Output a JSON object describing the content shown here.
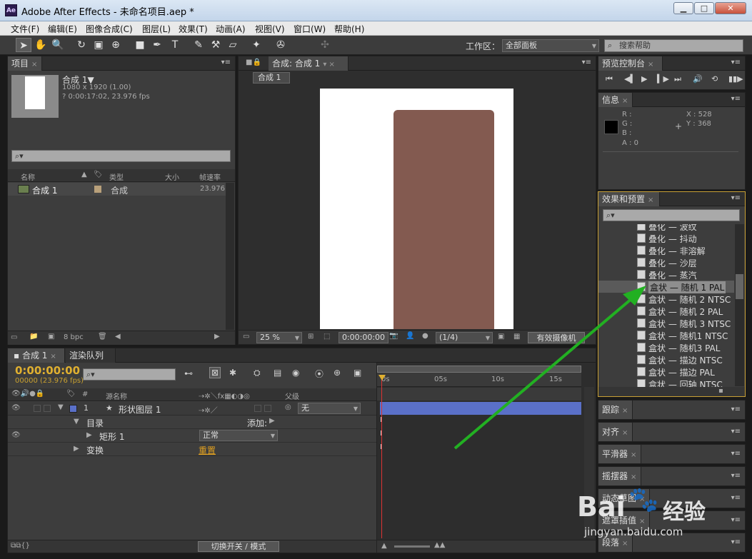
{
  "app": {
    "title": "Adobe After Effects - 未命名项目.aep *",
    "icon": "Ae"
  },
  "window_controls": {
    "minimize": "▁",
    "maximize": "□",
    "close": "✕"
  },
  "menu": [
    "文件(F)",
    "编辑(E)",
    "图像合成(C)",
    "图层(L)",
    "效果(T)",
    "动画(A)",
    "视图(V)",
    "窗口(W)",
    "帮助(H)"
  ],
  "toolbar": {
    "tools": [
      "selection-tool",
      "hand-tool",
      "zoom-tool",
      "rotate-tool",
      "camera-tool",
      "pan-behind-tool",
      "rectangle-tool",
      "pen-tool",
      "type-tool",
      "brush-tool",
      "clone-stamp-tool",
      "eraser-tool",
      "roto-brush-tool",
      "puppet-pin-tool"
    ],
    "workspace_label": "工作区：",
    "workspace_value": "全部面板",
    "search_help": "搜索帮助"
  },
  "project": {
    "tab": "项目",
    "comp_name": "合成 1▼",
    "comp_size": "1080 x 1920 (1.00)",
    "comp_duration": "? 0:00:17:02, 23.976 fps",
    "col_name": "名称",
    "col_type": "类型",
    "col_size": "大小",
    "col_fps": "帧速率",
    "item_name": "合成 1",
    "item_type": "合成",
    "item_fps": "23.976",
    "bpc": "8 bpc"
  },
  "composition": {
    "tab": "合成: 合成 1",
    "subtab": "合成 1",
    "zoom": "25 %",
    "timecode": "0:00:00:00",
    "resolution": "(1/4)",
    "camera": "有效摄像机",
    "shape_color": "#835a50"
  },
  "preview": {
    "tab": "预览控制台"
  },
  "info": {
    "tab": "信息",
    "r": "R :",
    "g": "G :",
    "b": "B :",
    "a": "A : 0",
    "x": "X : 528",
    "y": "Y : 368"
  },
  "effects": {
    "tab": "效果和预置",
    "items": [
      "叠化 — 波纹",
      "叠化 — 抖动",
      "叠化 — 非溶解",
      "叠化 — 沙层",
      "叠化 — 蒸汽",
      "盒状 — 随机 1 PAL",
      "盒状 — 随机 2 NTSC",
      "盒状 — 随机 2 PAL",
      "盒状 — 随机 3 NTSC",
      "盒状 — 随机1 NTSC",
      "盒状 — 随机3 PAL",
      "盒状 — 描边 NTSC",
      "盒状 — 描边 PAL",
      "盒状 — 回轴 NTSC"
    ],
    "selected_index": 5
  },
  "side_panels": [
    "跟踪",
    "对齐",
    "平滑器",
    "摇摆器",
    "动态草图",
    "遮罩插值",
    "段落"
  ],
  "timeline": {
    "tab": "合成 1",
    "render_tab": "渲染队列",
    "timecode": "0:00:00:00",
    "fps_sub": "00000 (23.976 fps)",
    "col_num": "#",
    "col_source": "源名称",
    "col_parent": "父级",
    "layer_num": "1",
    "layer_name": "形状图层 1",
    "parent_value": "无",
    "content_label": "目录",
    "add_label": "添加:",
    "rect_label": "矩形 1",
    "blend_value": "正常",
    "transform_label": "变换",
    "reset_label": "重置",
    "ruler": [
      "0s",
      "05s",
      "10s",
      "15s"
    ],
    "toggle_label": "切换开关 / 模式",
    "layer_color": "#5a70c8"
  },
  "watermark": {
    "text1": "Bai",
    "text2": "经验",
    "url": "jingyan.baidu.com"
  }
}
